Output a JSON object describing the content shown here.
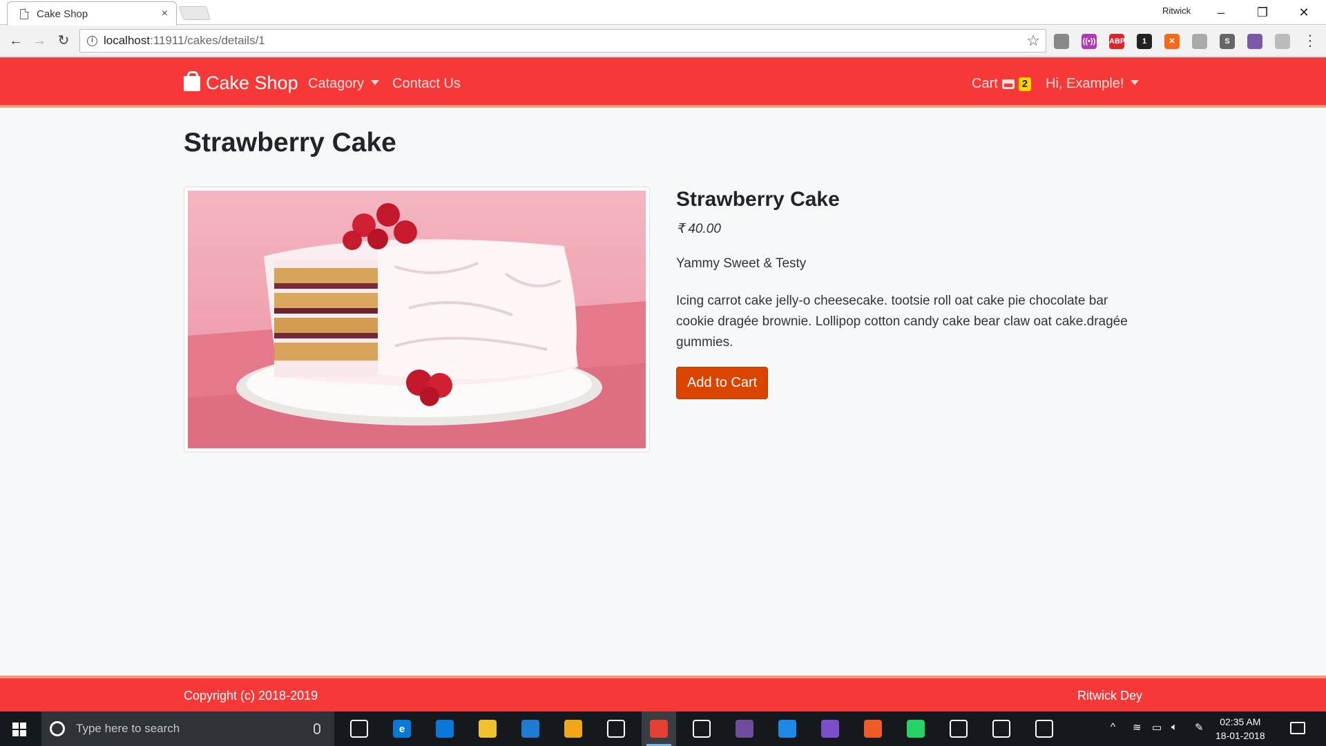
{
  "browser": {
    "tab_title": "Cake Shop",
    "tab_close": "×",
    "profile_name": "Ritwick",
    "url_host": "localhost",
    "url_path": ":11911/cakes/details/1",
    "window_controls": {
      "minimize": "–",
      "restore": "❐",
      "close": "✕"
    },
    "extensions": [
      {
        "name": "shield-ext-icon",
        "label": "",
        "color": "#888888"
      },
      {
        "name": "broadcast-ext-icon",
        "label": "((•))",
        "color": "#b03ab0"
      },
      {
        "name": "adblock-plus-icon",
        "label": "ABP",
        "color": "#d9262b"
      },
      {
        "name": "ghostery-icon",
        "label": "1",
        "color": "#222222"
      },
      {
        "name": "orange-ext-icon",
        "label": "✕",
        "color": "#f26b1d"
      },
      {
        "name": "page-ext-icon",
        "label": "",
        "color": "#aaaaaa"
      },
      {
        "name": "s-ext-icon",
        "label": "S",
        "color": "#666666"
      },
      {
        "name": "octocat-ext-icon",
        "label": "",
        "color": "#7a5aa8"
      },
      {
        "name": "tree-ext-icon",
        "label": "",
        "color": "#bbbbbb"
      }
    ]
  },
  "site": {
    "brand": "Cake Shop",
    "nav": {
      "category": "Catagory",
      "contact": "Contact Us",
      "cart": "Cart",
      "cart_count": "2",
      "user": "Hi, Example!"
    },
    "accent_color": "#f73838",
    "button_color": "#d94400"
  },
  "product": {
    "page_title": "Strawberry Cake",
    "name": "Strawberry Cake",
    "price": "₹ 40.00",
    "tagline": "Yammy Sweet & Testy",
    "description": "Icing carrot cake jelly-o cheesecake. tootsie roll oat cake pie chocolate bar cookie dragée brownie. Lollipop cotton candy cake bear claw oat cake.dragée gummies.",
    "add_to_cart": "Add to Cart"
  },
  "footer": {
    "copyright": "Copyright (c) 2018-2019",
    "author": "Ritwick Dey"
  },
  "taskbar": {
    "search_placeholder": "Type here to search",
    "apps": [
      {
        "name": "task-view-icon",
        "label": "",
        "color": "#15181c"
      },
      {
        "name": "edge-icon",
        "label": "e",
        "color": "#0a78d7"
      },
      {
        "name": "store-icon",
        "label": "",
        "color": "#0a78d7"
      },
      {
        "name": "file-explorer-icon",
        "label": "",
        "color": "#f2c12e"
      },
      {
        "name": "firefox-dev-icon",
        "label": "",
        "color": "#1f7ad1"
      },
      {
        "name": "yellow-app-icon",
        "label": "",
        "color": "#f0a818"
      },
      {
        "name": "groove-icon",
        "label": "",
        "color": "#15181c"
      },
      {
        "name": "chrome-icon",
        "label": "",
        "color": "#e44134"
      },
      {
        "name": "clapper-icon",
        "label": "",
        "color": "#15181c"
      },
      {
        "name": "github-desktop-icon",
        "label": "",
        "color": "#6e4c9e"
      },
      {
        "name": "vscode-icon",
        "label": "",
        "color": "#1e88e5"
      },
      {
        "name": "visual-studio-icon",
        "label": "",
        "color": "#7b4fc9"
      },
      {
        "name": "postman-icon",
        "label": "",
        "color": "#ef5b25"
      },
      {
        "name": "whatsapp-icon",
        "label": "",
        "color": "#25d366"
      },
      {
        "name": "tools-icon",
        "label": "",
        "color": "#15181c"
      },
      {
        "name": "terminal-icon",
        "label": "",
        "color": "#15181c"
      },
      {
        "name": "photos-icon",
        "label": "",
        "color": "#15181c"
      }
    ],
    "time": "02:35 AM",
    "date": "18-01-2018"
  }
}
